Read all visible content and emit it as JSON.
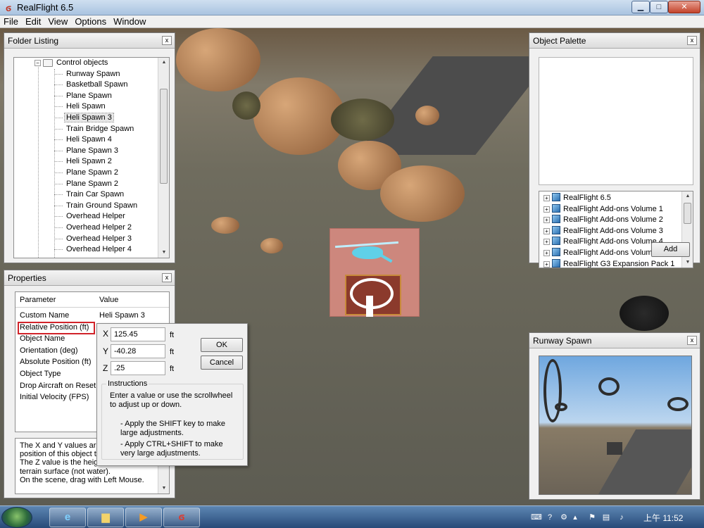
{
  "window": {
    "title": "RealFlight 6.5",
    "app_icon": "realflight-logo-icon",
    "controls": [
      "minimize-icon",
      "maximize-icon",
      "close-icon"
    ]
  },
  "menu": [
    "File",
    "Edit",
    "View",
    "Options",
    "Window"
  ],
  "folder_listing": {
    "title": "Folder Listing",
    "root": "Control objects",
    "selected": "Heli Spawn 3",
    "items": [
      "Runway Spawn",
      "Basketball Spawn",
      "Plane Spawn",
      "Heli Spawn",
      "Heli Spawn 3",
      "Train Bridge Spawn",
      "Heli Spawn 4",
      "Plane Spawn 3",
      "Heli Spawn 2",
      "Plane Spawn 2",
      "Plane Spawn 2",
      "Train Car Spawn",
      "Train Ground Spawn",
      "Overhead Helper",
      "Overhead Helper 2",
      "Overhead Helper 3",
      "Overhead Helper 4"
    ]
  },
  "properties": {
    "title": "Properties",
    "col_parameter": "Parameter",
    "col_value": "Value",
    "rows": [
      {
        "name": "Custom Name",
        "value": "Heli Spawn 3"
      },
      {
        "name": "Relative Position (ft)",
        "value": ""
      },
      {
        "name": "Object Name",
        "value": ""
      },
      {
        "name": "Orientation (deg)",
        "value": ""
      },
      {
        "name": "Absolute Position (ft)",
        "value": ""
      },
      {
        "name": "Object Type",
        "value": ""
      },
      {
        "name": "Drop Aircraft on Reset",
        "value": ""
      },
      {
        "name": "Initial Velocity (FPS)",
        "value": ""
      }
    ],
    "description": [
      "The X and Y values are t",
      "position of this object to",
      "The Z value is the heigh",
      "terrain surface (not water).",
      "On the scene, drag with Left Mouse."
    ]
  },
  "position_dialog": {
    "x_label": "X",
    "x_value": "125.45",
    "y_label": "Y",
    "y_value": "-40.28",
    "z_label": "Z",
    "z_value": ".25",
    "unit": "ft",
    "ok": "OK",
    "cancel": "Cancel",
    "instructions_title": "Instructions",
    "instructions_lines": [
      "Enter a value or use the scrollwheel",
      "to adjust up or down.",
      "",
      "- Apply the SHIFT key to make",
      "large adjustments.",
      "- Apply CTRL+SHIFT to make",
      "very large adjustments."
    ]
  },
  "object_palette": {
    "title": "Object Palette",
    "items": [
      "RealFlight 6.5",
      "RealFlight Add-ons Volume 1",
      "RealFlight Add-ons Volume 2",
      "RealFlight Add-ons Volume 3",
      "RealFlight Add-ons Volume 4",
      "RealFlight Add-ons Volume 5",
      "RealFlight G3 Expansion Pack 1"
    ],
    "add_label": "Add"
  },
  "runway_panel": {
    "title": "Runway Spawn"
  },
  "taskbar": {
    "apps": [
      "internet-explorer-icon",
      "file-explorer-icon",
      "media-player-icon",
      "realflight-task-icon"
    ],
    "clock": "上午 11:52"
  }
}
